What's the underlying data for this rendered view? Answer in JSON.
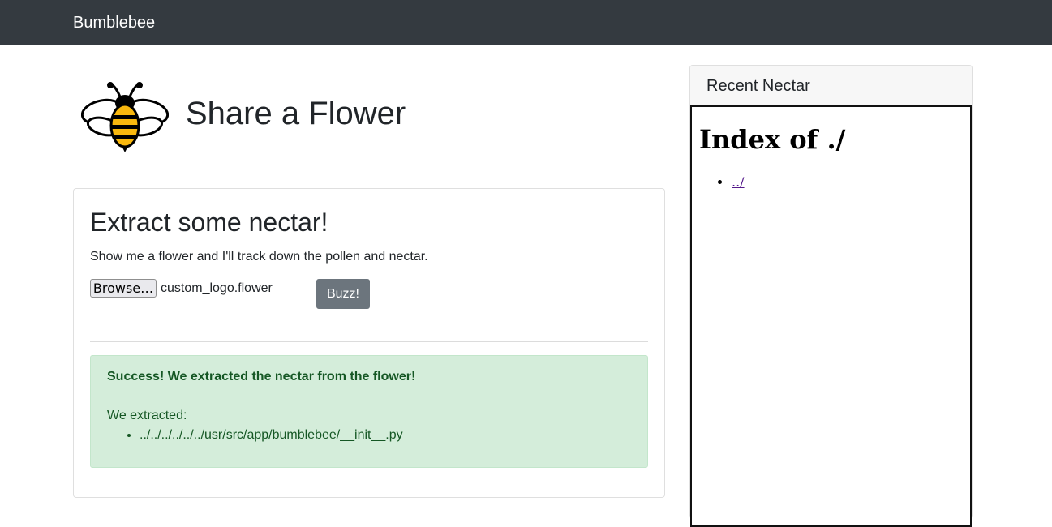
{
  "navbar": {
    "brand": "Bumblebee"
  },
  "header": {
    "logo_icon": "bee-icon",
    "title": "Share a Flower"
  },
  "upload_card": {
    "heading": "Extract some nectar!",
    "description": "Show me a flower and I'll track down the pollen and nectar.",
    "browse_label": "Browse…",
    "selected_file": "custom_logo.flower",
    "submit_label": "Buzz!"
  },
  "alert": {
    "title": "Success! We extracted the nectar from the flower!",
    "label": "We extracted:",
    "items": [
      "../../../../../../usr/src/app/bumblebee/__init__.py"
    ]
  },
  "sidebar": {
    "title": "Recent Nectar",
    "index_title": "Index of ./",
    "links": [
      "../"
    ]
  },
  "colors": {
    "navbar_bg": "#343a40",
    "alert_bg": "#d4edda",
    "alert_text": "#155724",
    "buzz_button_bg": "#6c757d",
    "bee_yellow": "#f9b80e"
  }
}
